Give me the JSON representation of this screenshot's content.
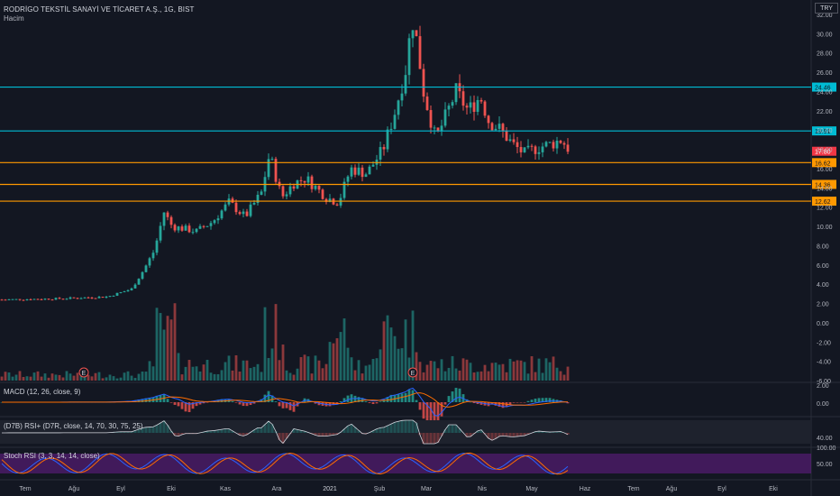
{
  "header": {
    "title": "RODRİGO TEKSTİL SANAYİ VE TİCARET A.Ş., 1G, BIST",
    "subtitle": "Hacim",
    "currency": "TRY"
  },
  "colors": {
    "background": "#131722",
    "up": "#26a69a",
    "down": "#ef5350",
    "resistance_line": "#00bcd4",
    "support_line": "#ff9800",
    "last_price": "#f23645",
    "macd_line": "#2962ff",
    "signal_line": "#ff6d00",
    "rsi_fill": "#7b1fa2"
  },
  "panes": {
    "macd_label": "MACD (12, 26, close, 9)",
    "rsi_label": "(D7B) RSI+ (D7R, close, 14, 70, 30, 75, 25)",
    "stoch_label": "Stoch RSI (3, 3, 14, 14, close)"
  },
  "chart_data": {
    "type": "candlestick",
    "title": "RODRİGO TEKSTİL SANAYİ VE TİCARET A.Ş., 1G, BIST",
    "y_ticks": [
      "32.00",
      "30.00",
      "28.00",
      "26.00",
      "24.00",
      "22.00",
      "20.00",
      "18.00",
      "16.00",
      "14.00",
      "12.00",
      "10.00",
      "8.00",
      "6.00",
      "4.00",
      "2.00",
      "0.00",
      "-2.00",
      "-4.00",
      "-6.00"
    ],
    "ylim": [
      -6,
      32
    ],
    "x_labels": [
      "Tem",
      "Ağu",
      "Eyl",
      "Eki",
      "Kas",
      "Ara",
      "2021",
      "Şub",
      "Mar",
      "Nis",
      "May",
      "Haz",
      "Tem",
      "Ağu",
      "Eyl",
      "Eki"
    ],
    "price_path": [
      [
        0,
        2.4
      ],
      [
        0.07,
        2.5
      ],
      [
        0.13,
        2.7
      ],
      [
        0.16,
        3.5
      ],
      [
        0.175,
        5.5
      ],
      [
        0.188,
        7.5
      ],
      [
        0.2,
        11.5
      ],
      [
        0.21,
        10.0
      ],
      [
        0.24,
        9.5
      ],
      [
        0.26,
        10.5
      ],
      [
        0.28,
        12.5
      ],
      [
        0.3,
        11.0
      ],
      [
        0.32,
        13.5
      ],
      [
        0.33,
        17.5
      ],
      [
        0.345,
        13.0
      ],
      [
        0.36,
        14.5
      ],
      [
        0.375,
        15.0
      ],
      [
        0.4,
        13.0
      ],
      [
        0.415,
        12.5
      ],
      [
        0.43,
        16.0
      ],
      [
        0.45,
        15.5
      ],
      [
        0.47,
        18.0
      ],
      [
        0.485,
        22.0
      ],
      [
        0.5,
        27.0
      ],
      [
        0.505,
        32.0
      ],
      [
        0.512,
        29.0
      ],
      [
        0.52,
        24.0
      ],
      [
        0.535,
        19.0
      ],
      [
        0.545,
        21.0
      ],
      [
        0.56,
        24.0
      ],
      [
        0.575,
        22.0
      ],
      [
        0.59,
        23.5
      ],
      [
        0.6,
        21.0
      ],
      [
        0.615,
        20.0
      ],
      [
        0.63,
        18.5
      ],
      [
        0.645,
        17.5
      ],
      [
        0.66,
        18.2
      ],
      [
        0.675,
        18.5
      ],
      [
        0.69,
        19.0
      ],
      [
        0.7,
        17.9
      ]
    ],
    "levels": [
      {
        "label": "24.46",
        "value": 24.46,
        "kind": "resistance"
      },
      {
        "label": "19.91",
        "value": 19.91,
        "kind": "resistance"
      },
      {
        "label": "16.62",
        "value": 16.62,
        "kind": "support"
      },
      {
        "label": "14.36",
        "value": 14.36,
        "kind": "support"
      },
      {
        "label": "12.62",
        "value": 12.62,
        "kind": "support"
      }
    ],
    "last_price": {
      "label": "17.80",
      "value": 17.8
    },
    "macd_ticks": [
      "2.00",
      "0.00"
    ],
    "rsi_ticks": [
      "40.00"
    ],
    "stoch_ticks": [
      "100.00",
      "50.00"
    ],
    "earnings_markers": [
      "E",
      "E"
    ]
  }
}
